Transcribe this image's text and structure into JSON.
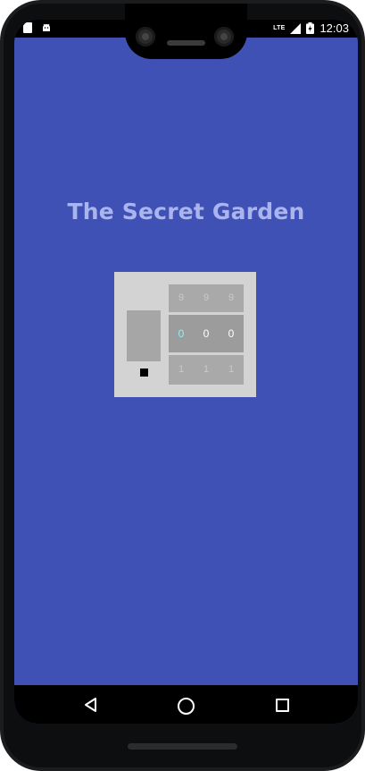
{
  "status_bar": {
    "time": "12:03",
    "network": "LTE",
    "icons": [
      "sdcard-icon",
      "android-icon",
      "signal-icon",
      "battery-icon"
    ]
  },
  "app": {
    "title": "The Secret Garden",
    "background_color": "#3f51b5",
    "title_color": "#aab4ee"
  },
  "lock": {
    "dials": [
      {
        "above": "9",
        "value": "0",
        "below": "1",
        "selected": true
      },
      {
        "above": "9",
        "value": "0",
        "below": "1",
        "selected": false
      },
      {
        "above": "9",
        "value": "0",
        "below": "1",
        "selected": false
      }
    ]
  },
  "navigation": {
    "icons": [
      "back-icon",
      "home-icon",
      "recents-icon"
    ]
  }
}
